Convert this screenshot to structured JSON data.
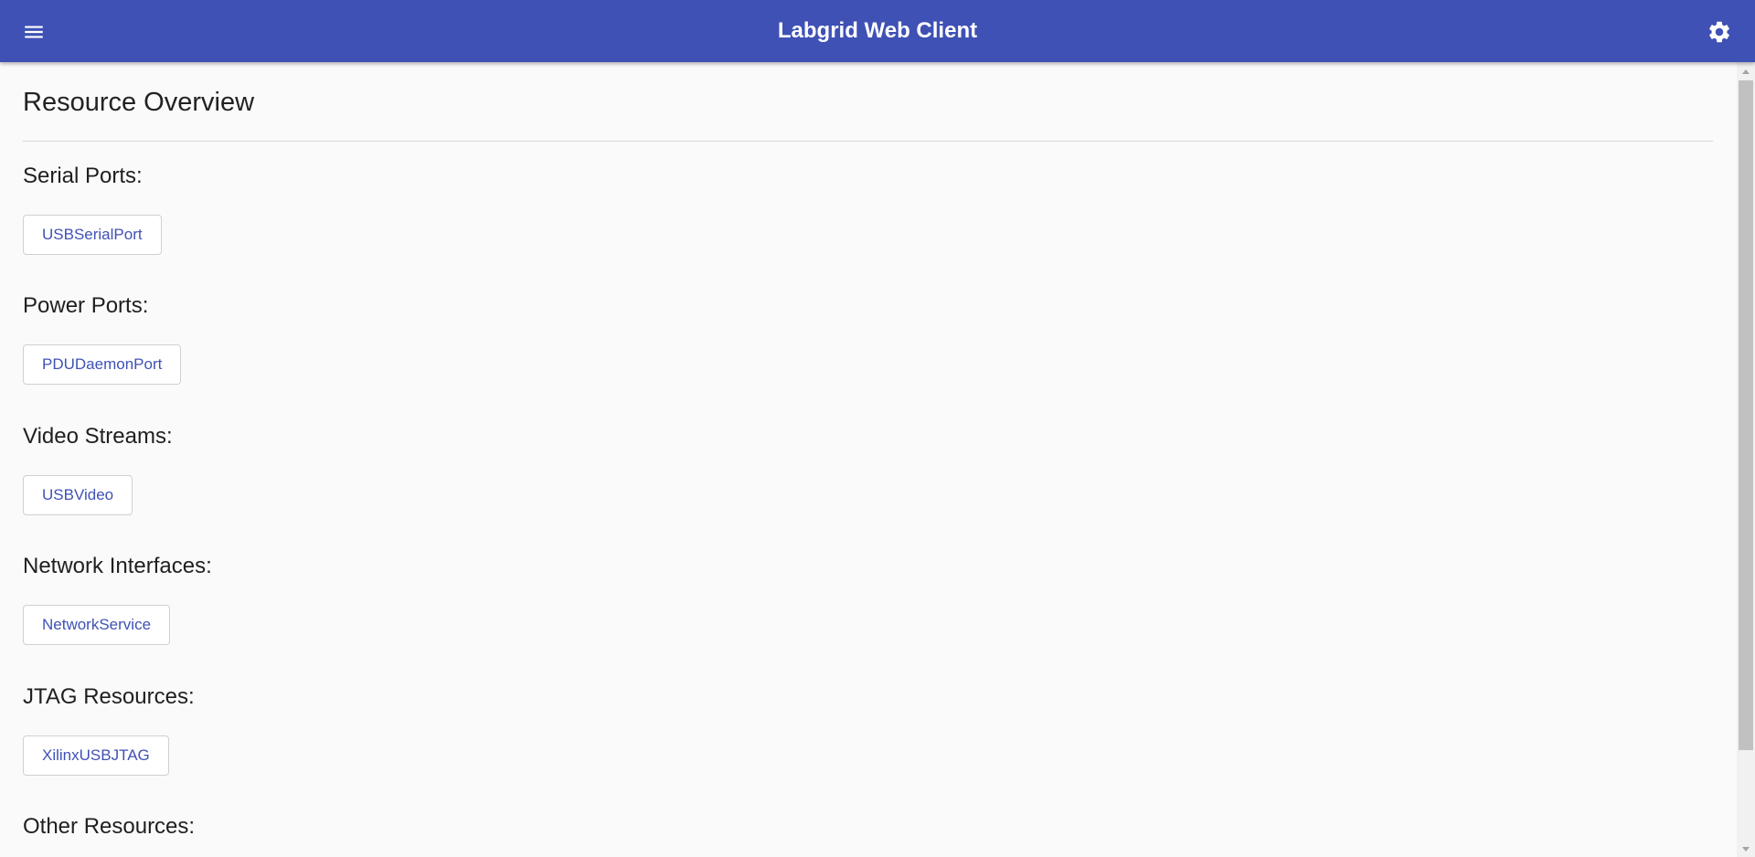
{
  "header": {
    "title": "Labgrid Web Client",
    "menu_icon": "menu-icon",
    "settings_icon": "gear-icon",
    "background_color": "#3f51b5"
  },
  "main": {
    "page_title": "Resource Overview",
    "sections": [
      {
        "title": "Serial Ports:",
        "resources": [
          "USBSerialPort"
        ]
      },
      {
        "title": "Power Ports:",
        "resources": [
          "PDUDaemonPort"
        ]
      },
      {
        "title": "Video Streams:",
        "resources": [
          "USBVideo"
        ]
      },
      {
        "title": "Network Interfaces:",
        "resources": [
          "NetworkService"
        ]
      },
      {
        "title": "JTAG Resources:",
        "resources": [
          "XilinxUSBJTAG"
        ]
      },
      {
        "title": "Other Resources:",
        "resources": []
      }
    ]
  },
  "colors": {
    "accent": "#3f51b5",
    "page_background": "#fafafa",
    "chip_border": "#d0d0d0"
  }
}
